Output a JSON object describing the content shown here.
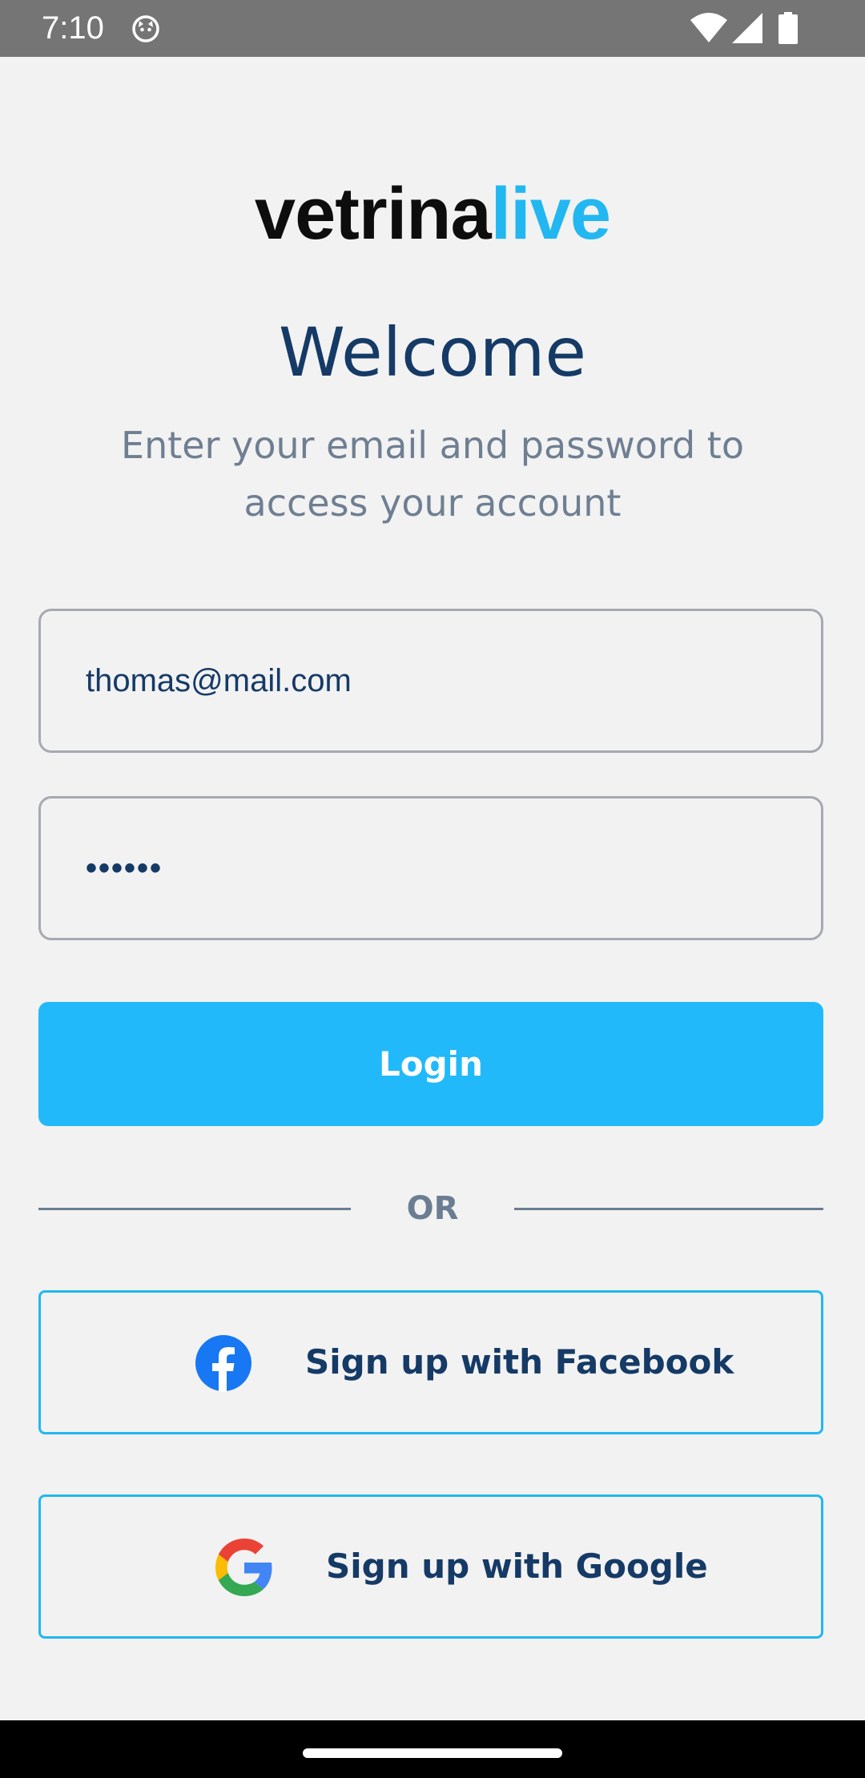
{
  "status_bar": {
    "time": "7:10",
    "icons": [
      "app-notification-icon",
      "wifi-icon",
      "signal-icon",
      "battery-icon"
    ]
  },
  "logo": {
    "part_a": "vetrina",
    "part_b": "live",
    "colors": {
      "part_a": "#0d0d0d",
      "part_b": "#22b7f1"
    }
  },
  "header": {
    "title": "Welcome",
    "subtitle": "Enter your email and password to access your account"
  },
  "form": {
    "email_value": "thomas@mail.com",
    "password_value": "••••••",
    "login_label": "Login"
  },
  "divider": {
    "label": "OR"
  },
  "social": {
    "facebook_label": "Sign up with Facebook",
    "google_label": "Sign up with Google",
    "facebook_icon": "facebook-icon",
    "google_icon": "google-icon"
  },
  "colors": {
    "accent": "#22b9fa",
    "title": "#153a66",
    "subtitle": "#6f7f92",
    "background": "#f2f2f2"
  }
}
